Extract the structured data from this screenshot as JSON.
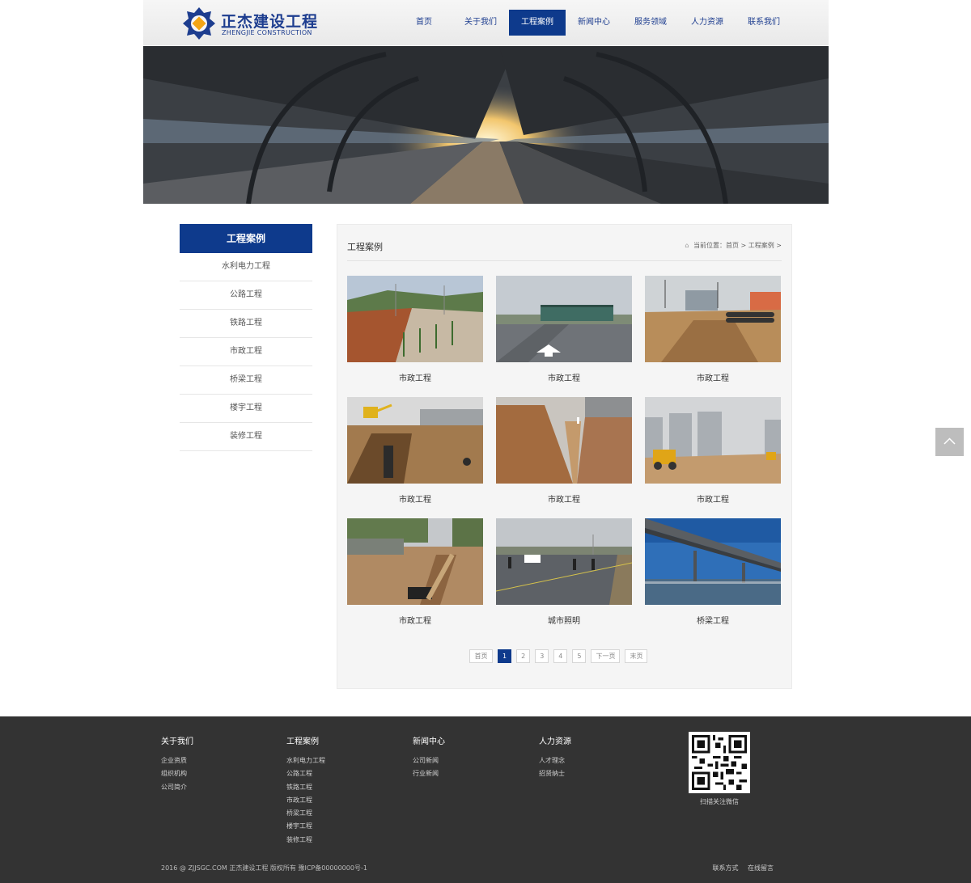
{
  "header": {
    "logo_cn": "正杰建设工程",
    "logo_en": "ZHENGJIE CONSTRUCTION",
    "nav": [
      "首页",
      "关于我们",
      "工程案例",
      "新闻中心",
      "服务领域",
      "人力资源",
      "联系我们"
    ],
    "active_nav": "工程案例"
  },
  "sidebar": {
    "title": "工程案例",
    "items": [
      "水利电力工程",
      "公路工程",
      "铁路工程",
      "市政工程",
      "桥梁工程",
      "楼宇工程",
      "装修工程"
    ]
  },
  "main": {
    "title": "工程案例",
    "breadcrumb": "当前位置：首页 > 工程案例 >",
    "cards": [
      {
        "label": "市政工程",
        "scene": "tree-road"
      },
      {
        "label": "市政工程",
        "scene": "bus-road"
      },
      {
        "label": "市政工程",
        "scene": "pipe-dig"
      },
      {
        "label": "市政工程",
        "scene": "trench-excavator"
      },
      {
        "label": "市政工程",
        "scene": "trench-deep"
      },
      {
        "label": "市政工程",
        "scene": "towers-site"
      },
      {
        "label": "市政工程",
        "scene": "pipe-roadside"
      },
      {
        "label": "城市照明",
        "scene": "street-work"
      },
      {
        "label": "桥梁工程",
        "scene": "bridge"
      }
    ],
    "pager": {
      "first": "首页",
      "pages": [
        "1",
        "2",
        "3",
        "4",
        "5"
      ],
      "current": "1",
      "next": "下一页",
      "last": "末页"
    }
  },
  "footer": {
    "columns": [
      {
        "title": "关于我们",
        "links": [
          "企业资质",
          "组织机构",
          "公司简介"
        ]
      },
      {
        "title": "工程案例",
        "links": [
          "水利电力工程",
          "公路工程",
          "铁路工程",
          "市政工程",
          "桥梁工程",
          "楼宇工程",
          "装修工程"
        ]
      },
      {
        "title": "新闻中心",
        "links": [
          "公司新闻",
          "行业新闻"
        ]
      },
      {
        "title": "人力资源",
        "links": [
          "人才理念",
          "招贤纳士"
        ]
      }
    ],
    "qr_caption": "扫描关注微信",
    "copyright": "2016 @ ZJJSGC.COM 正杰建设工程 版权所有   豫ICP备00000000号-1",
    "links": [
      "联系方式",
      "在线留言"
    ]
  },
  "colors": {
    "brand": "#0e3a8c",
    "footer_bg": "#333333",
    "panel_bg": "#f5f5f5"
  },
  "icons": [
    "logo-mark",
    "home-icon",
    "chevron-up-icon",
    "qr-code"
  ]
}
